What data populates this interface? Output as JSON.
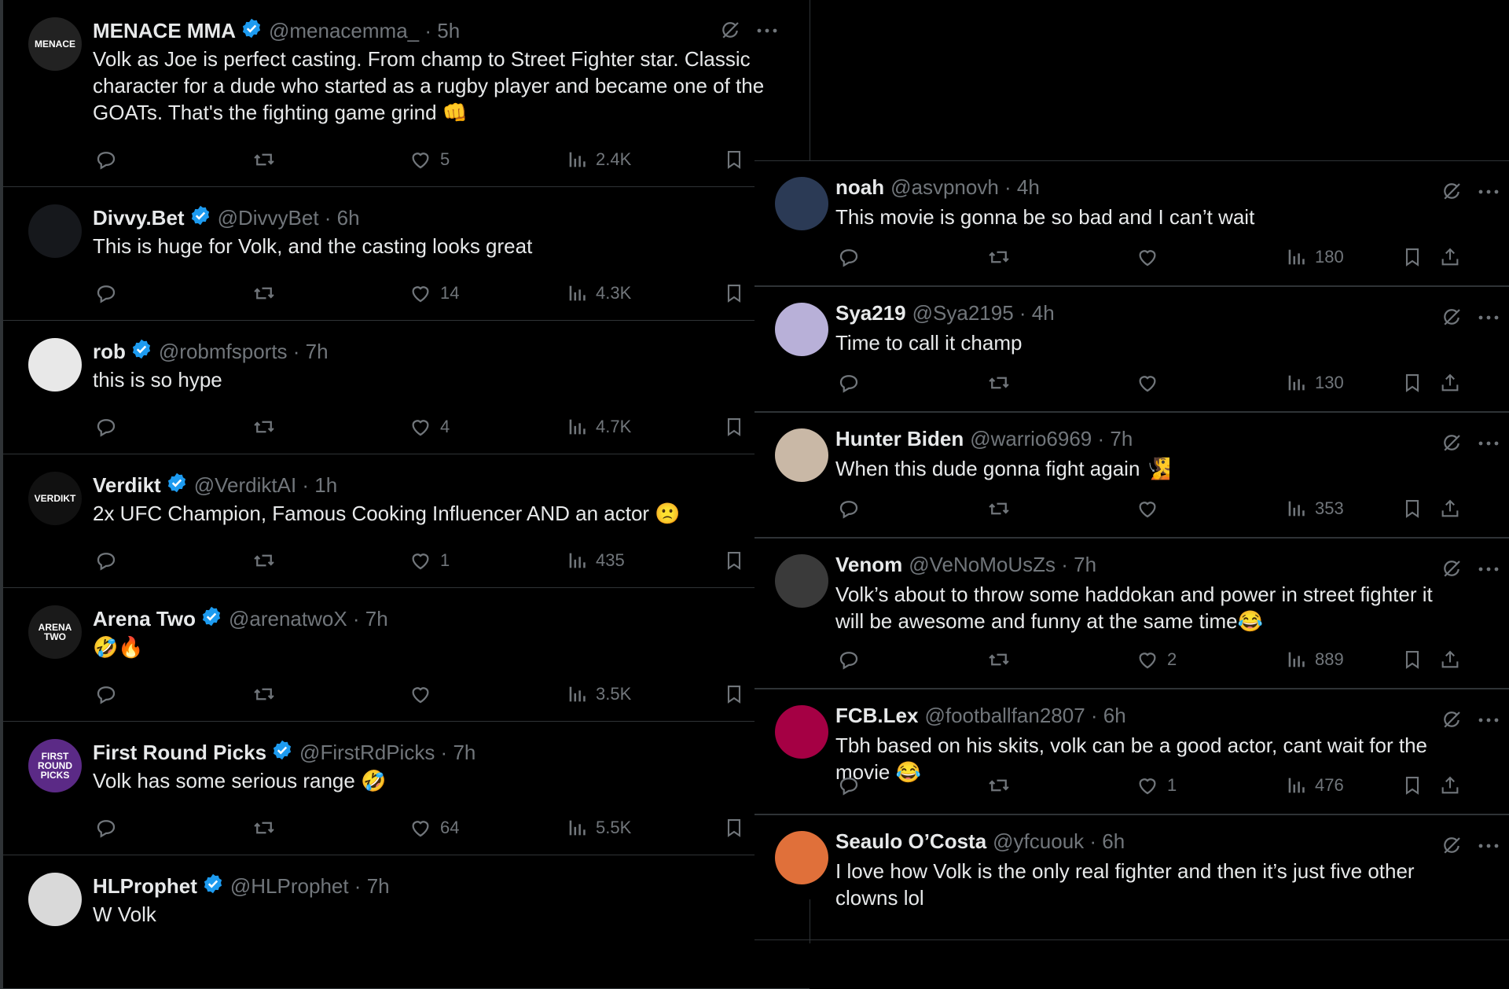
{
  "colors": {
    "background": "#000000",
    "text": "#e7e9ea",
    "muted": "#71767b",
    "border": "#2f3336",
    "verified": "#1d9bf0"
  },
  "left_tweets": [
    {
      "avatar": "MENACE",
      "avatar_color": "#222222",
      "name": "MENACE MMA",
      "verified": true,
      "handle": "@menacemma_ · 5h",
      "text": "Volk as Joe is perfect casting. From champ to Street Fighter star. Classic character for a dude who started as a rugby player and became one of the GOATs. That's the fighting game grind 👊",
      "likes": "5",
      "views": "2.4K"
    },
    {
      "avatar": "",
      "avatar_color": "#16181c",
      "name": "Divvy.Bet",
      "verified": true,
      "handle": "@DivvyBet · 6h",
      "text": "This is huge for Volk, and the casting looks great",
      "likes": "14",
      "views": "4.3K"
    },
    {
      "avatar": "",
      "avatar_color": "#e8e8e8",
      "name": "rob",
      "verified": true,
      "handle": "@robmfsports · 7h",
      "text": "this is so hype",
      "likes": "4",
      "views": "4.7K"
    },
    {
      "avatar": "VERDIKT",
      "avatar_color": "#111111",
      "name": "Verdikt",
      "verified": true,
      "handle": "@VerdiktAI · 1h",
      "text": "2x UFC Champion, Famous Cooking Influencer AND an actor 🙁",
      "likes": "1",
      "views": "435"
    },
    {
      "avatar": "ARENA TWO",
      "avatar_color": "#1a1a1a",
      "name": "Arena Two",
      "verified": true,
      "handle": "@arenatwoX · 7h",
      "text": "🤣🔥",
      "likes": "",
      "views": "3.5K"
    },
    {
      "avatar": "FIRST ROUND PICKS",
      "avatar_color": "#5b2a86",
      "name": "First Round Picks",
      "verified": true,
      "handle": "@FirstRdPicks · 7h",
      "text": "Volk has some serious range 🤣",
      "likes": "64",
      "views": "5.5K"
    },
    {
      "avatar": "",
      "avatar_color": "#d9d9d9",
      "name": "HLProphet",
      "verified": true,
      "handle": "@HLProphet · 7h",
      "text": "W Volk",
      "likes": "",
      "views": ""
    }
  ],
  "right_tweets": [
    {
      "avatar": "",
      "avatar_color": "#2b3a55",
      "name": "noah",
      "verified": false,
      "handle": "@asvpnovh · 4h",
      "text": "This movie is gonna be so bad and I can’t wait",
      "likes": "",
      "views": "180"
    },
    {
      "avatar": "",
      "avatar_color": "#b8b0d8",
      "name": "Sya219",
      "verified": false,
      "handle": "@Sya2195 · 4h",
      "text": "Time to call it champ",
      "likes": "",
      "views": "130"
    },
    {
      "avatar": "",
      "avatar_color": "#c9b8a6",
      "name": "Hunter Biden",
      "verified": false,
      "handle": "@warrio6969 · 7h",
      "text": "When this dude gonna fight again 🧏",
      "likes": "",
      "views": "353"
    },
    {
      "avatar": "",
      "avatar_color": "#3a3a3a",
      "name": "Venom",
      "verified": false,
      "handle": "@VeNoMoUsZs · 7h",
      "text": "Volk’s about to throw some haddokan and power in street fighter it will be awesome and funny at the same time😂",
      "likes": "2",
      "views": "889"
    },
    {
      "avatar": "",
      "avatar_color": "#a50044",
      "name": "FCB.Lex",
      "verified": false,
      "handle": "@footballfan2807 · 6h",
      "text": "Tbh based on his skits, volk can be a good actor, cant wait for the movie 😂",
      "likes": "1",
      "views": "476"
    },
    {
      "avatar": "",
      "avatar_color": "#e0703a",
      "name": "Seaulo O’Costa",
      "verified": false,
      "handle": "@yfcuouk · 6h",
      "text": "I love how Volk is the only real fighter and then it’s just five other clowns lol",
      "likes": "",
      "views": ""
    }
  ]
}
